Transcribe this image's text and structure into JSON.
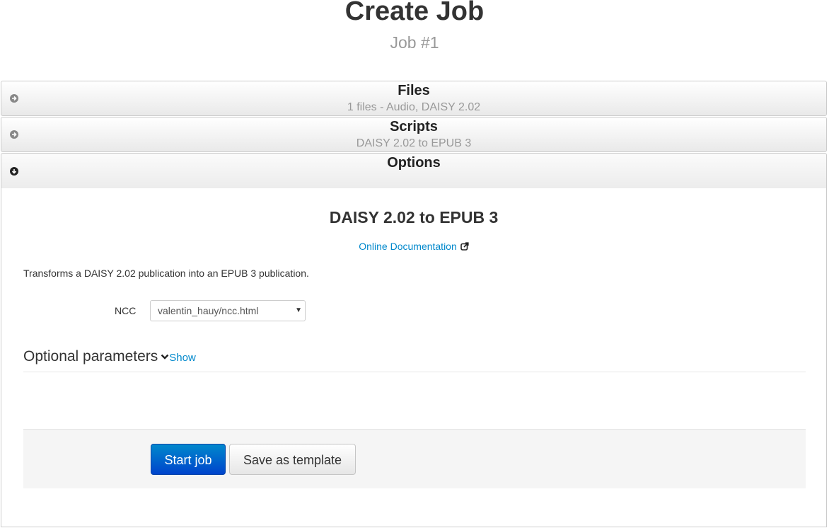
{
  "header": {
    "title": "Create Job",
    "subtitle": "Job #1"
  },
  "accordion": {
    "files": {
      "title": "Files",
      "summary": "1 files - Audio, DAISY 2.02",
      "icon": "arrow-circle-right-icon"
    },
    "scripts": {
      "title": "Scripts",
      "summary": "DAISY 2.02 to EPUB 3",
      "icon": "arrow-circle-right-icon"
    },
    "options": {
      "title": "Options",
      "icon": "arrow-circle-down-icon"
    }
  },
  "options": {
    "script_title": "DAISY 2.02 to EPUB 3",
    "doc_link_label": "Online Documentation",
    "doc_link_icon": "external-link-icon",
    "description": "Transforms a DAISY 2.02 publication into an EPUB 3 publication.",
    "ncc": {
      "label": "NCC",
      "selected": "valentin_hauy/ncc.html"
    },
    "optional_parameters": {
      "label": "Optional parameters",
      "toggle_label": "Show",
      "icon": "chevron-down-icon"
    },
    "actions": {
      "start_label": "Start job",
      "template_label": "Save as template"
    }
  },
  "colors": {
    "link": "#0088cc",
    "primary_button": "#0066cc",
    "muted_text": "#999999"
  }
}
